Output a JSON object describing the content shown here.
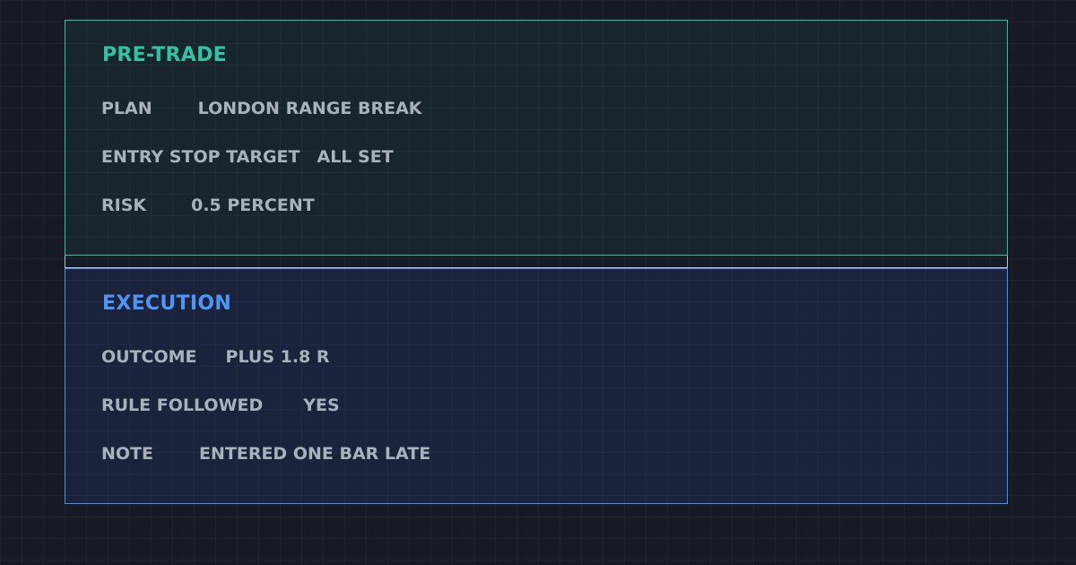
{
  "pre_trade": {
    "title": "PRE-TRADE",
    "accent_color": "#2ec4a5",
    "rows": [
      {
        "label": "PLAN",
        "value": "LONDON RANGE BREAK"
      },
      {
        "label": "ENTRY STOP TARGET",
        "value": "ALL SET"
      },
      {
        "label": "RISK",
        "value": "0.5 PERCENT"
      }
    ]
  },
  "execution": {
    "title": "EXECUTION",
    "accent_color": "#4f95f5",
    "rows": [
      {
        "label": "OUTCOME",
        "value": "PLUS 1.8 R"
      },
      {
        "label": "RULE FOLLOWED",
        "value": "YES"
      },
      {
        "label": "NOTE",
        "value": "ENTERED ONE BAR LATE"
      }
    ]
  }
}
